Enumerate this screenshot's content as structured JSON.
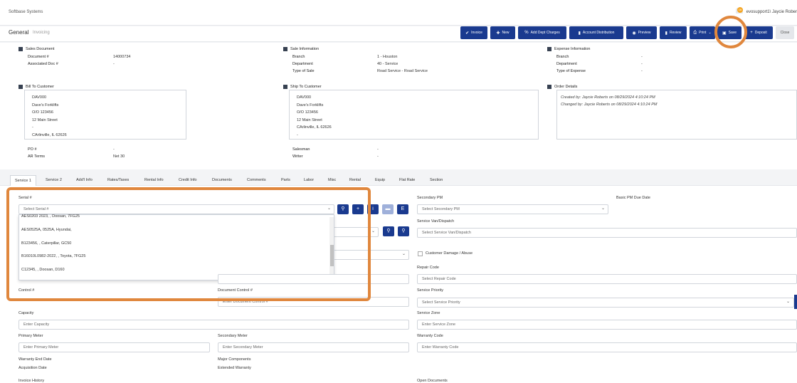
{
  "app": {
    "name": "Softbase Systems",
    "user": "evosupport1\\ Jaycie Rober",
    "notif_count": "16"
  },
  "header": {
    "title": "General",
    "subtitle": "Invoicing"
  },
  "toolbar": {
    "invoice": "Invoice",
    "new": "New",
    "add_dept": "Add Dept Charges",
    "account": "Account Distribution",
    "preview": "Preview",
    "review": "Review",
    "print": "Print",
    "save": "Save",
    "deposit": "Deposit",
    "close": "Close"
  },
  "sales_doc": {
    "heading": "Sales Document",
    "doc_label": "Document #",
    "doc_value": "14000734",
    "assoc_label": "Associated Doc #",
    "assoc_value": "-"
  },
  "sale_info": {
    "heading": "Sale Information",
    "branch_label": "Branch",
    "branch_value": "1 - Houston",
    "dept_label": "Department",
    "dept_value": "40 - Service",
    "type_label": "Type of Sale",
    "type_value": "Road Service - Road Service"
  },
  "expense": {
    "heading": "Expense Information",
    "branch_label": "Branch",
    "branch_value": "-",
    "dept_label": "Department",
    "dept_value": "-",
    "type_label": "Type of Expense",
    "type_value": "-"
  },
  "bill_to": {
    "heading": "Bill To Customer",
    "lines": [
      "DAV000",
      "Dave's Forklifts",
      "O/O 123456",
      "12 Main Street",
      "-",
      "CArlinville, IL 62626"
    ]
  },
  "ship_to": {
    "heading": "Ship To Customer",
    "lines": [
      "DAV000",
      "Dave's Forklifts",
      "O/O 123456",
      "12 Main Street",
      "CArlinville, IL 62626",
      "-"
    ]
  },
  "order": {
    "heading": "Order Details",
    "created": "Created by: Jaycie Roberts on 08/29/2024 4:10:24 PM",
    "changed": "Changed by: Jaycie Roberts on 08/29/2024 4:10:24 PM"
  },
  "misc": {
    "po_label": "PO #",
    "po_value": "-",
    "ar_label": "AR Terms",
    "ar_value": "Net 30",
    "salesman_label": "Salesman",
    "salesman_value": "-",
    "writer_label": "Writer",
    "writer_value": "-"
  },
  "tabs": [
    "Service 1",
    "Service 2",
    "Add'l Info",
    "Rates/Taxes",
    "Rental Info",
    "Credit Info",
    "Documents",
    "Comments",
    "Parts",
    "Labor",
    "Misc",
    "Rental",
    "Equip",
    "Flat Rate",
    "Section"
  ],
  "form": {
    "serial_label": "Serial #",
    "serial_placeholder": "Select Serial #",
    "dropdown": [
      "AES0203 2023, , Doosan, 7FG25",
      "AES0525A, 0525A, Hyundai,",
      "B123456, , Caterpillar, GC50",
      "B16010L0982-2022, , Toyota, 7FG25",
      "C12345, , Doosan, D160"
    ],
    "secondary_pm_label": "Secondary PM",
    "secondary_pm_placeholder": "Select Secondary PM",
    "basic_pm_label": "Basic PM Due Date",
    "service_van_label": "Service Van/Dispatch",
    "service_van_placeholder": "Select Service Van/Dispatch",
    "damage_label": "Customer Damage / Abuse",
    "repair_label": "Repair Code",
    "repair_placeholder": "Select Repair Code",
    "control_label": "Control #",
    "doc_control_label": "Document Control #",
    "doc_control_placeholder": "Enter Document Control #",
    "priority_label": "Service Priority",
    "priority_placeholder": "Select Service Priority",
    "capacity_label": "Capacity",
    "capacity_placeholder": "Enter Capacity",
    "zone_label": "Service Zone",
    "zone_placeholder": "Enter Service Zone",
    "primary_meter_label": "Primary Meter",
    "primary_meter_placeholder": "Enter Primary Meter",
    "secondary_meter_label": "Secondary Meter",
    "secondary_meter_placeholder": "Enter Secondary Meter",
    "warranty_code_label": "Warranty Code",
    "warranty_code_placeholder": "Enter Warranty Code",
    "warranty_end_label": "Warranty End Date",
    "acq_label": "Acquisition Date",
    "major_label": "Major Components",
    "ext_warranty_label": "Extended Warranty",
    "invoice_history_label": "Invoice History",
    "open_docs_label": "Open Documents"
  },
  "colors": {
    "primary": "#1a3a8f",
    "highlight": "#e0873d"
  }
}
